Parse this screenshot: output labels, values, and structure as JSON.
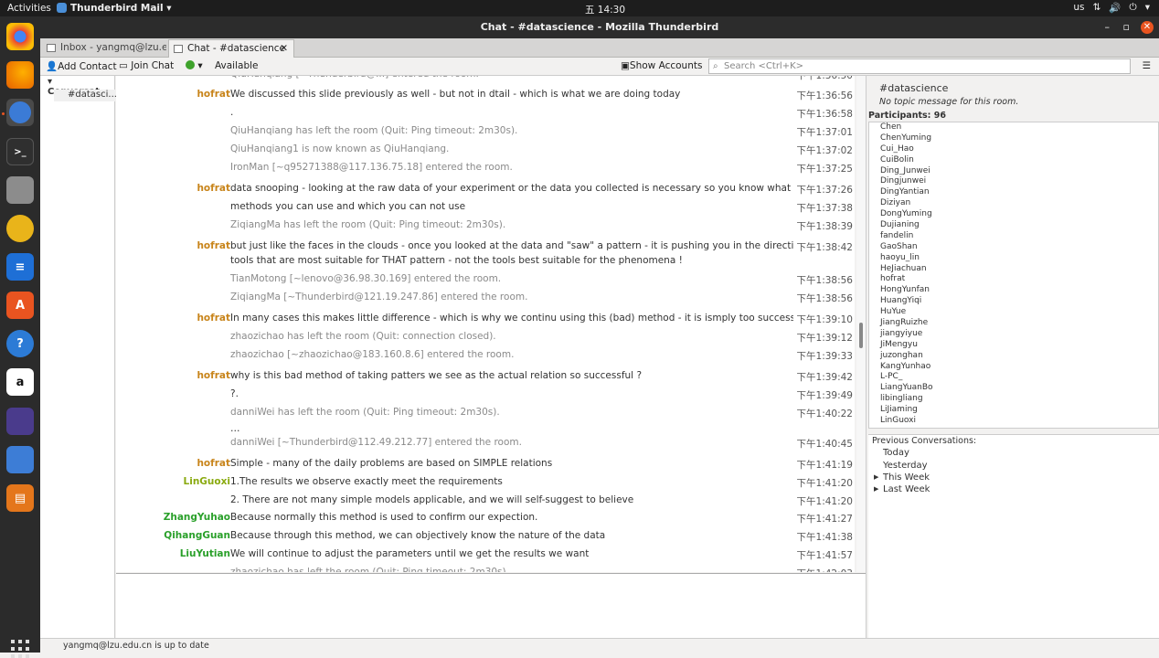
{
  "system": {
    "activities": "Activities",
    "app_name": "Thunderbird Mail",
    "clock": "五 14:30",
    "keyboard": "us"
  },
  "window": {
    "title": "Chat - #datascience - Mozilla Thunderbird"
  },
  "tabs": [
    {
      "label": "Inbox - yangmq@lzu.edu."
    },
    {
      "label": "Chat - #datascience"
    }
  ],
  "toolbar": {
    "add_contact": "Add Contact",
    "join_chat": "Join Chat",
    "status": "Available",
    "show_accounts": "Show Accounts",
    "search_placeholder": "Search <Ctrl+K>"
  },
  "sidebar": {
    "header": "Conversat...",
    "item": "#datasci..."
  },
  "chat": {
    "messages": [
      {
        "n": "",
        "m": "QiuHanqiang [~Thunderbird@...] entered the room.",
        "t": "下午1:36:50",
        "s": true,
        "nc": "#2aa02a"
      },
      {
        "n": "hofrat",
        "m": "We discussed this slide previously as well - but not in dtail - which is what we are doing today",
        "t": "下午1:36:56",
        "nc": "#c8841a"
      },
      {
        "n": "",
        "m": ".",
        "t": "下午1:36:58"
      },
      {
        "n": "",
        "m": "QiuHanqiang has left the room (Quit: Ping timeout: 2m30s).",
        "t": "下午1:37:01",
        "s": true
      },
      {
        "n": "",
        "m": "QiuHanqiang1 is now known as QiuHanqiang.",
        "t": "下午1:37:02",
        "s": true
      },
      {
        "n": "",
        "m": "IronMan [~q95271388@117.136.75.18] entered the room.",
        "t": "下午1:37:25",
        "s": true
      },
      {
        "n": "hofrat",
        "m": "data snooping - looking at the raw data of your experiment or the data you collected is necessary so you know what",
        "t": "下午1:37:26",
        "nc": "#c8841a"
      },
      {
        "n": "",
        "m": "methods you can use and which you can not use",
        "t": "下午1:37:38"
      },
      {
        "n": "",
        "m": "ZiqiangMa has left the room (Quit: Ping timeout: 2m30s).",
        "t": "下午1:38:39",
        "s": true
      },
      {
        "n": "hofrat",
        "m": "but just like the faces in the clouds - once you looked at the data and \"saw\" a pattern - it is pushing you in the direction of te",
        "t": "下午1:38:42",
        "nc": "#c8841a"
      },
      {
        "n": "",
        "m": "tools that are most suitable for THAT pattern - not the tools best suitable for the phenomena !",
        "t": ""
      },
      {
        "n": "",
        "m": "TianMotong [~lenovo@36.98.30.169] entered the room.",
        "t": "下午1:38:56",
        "s": true
      },
      {
        "n": "",
        "m": "ZiqiangMa [~Thunderbird@121.19.247.86] entered the room.",
        "t": "下午1:38:56",
        "s": true
      },
      {
        "n": "hofrat",
        "m": "In many cases this makes little difference - which is why we continu using this (bad) method - it is ismply too successful",
        "t": "下午1:39:10",
        "nc": "#c8841a"
      },
      {
        "n": "",
        "m": "zhaozichao has left the room (Quit: connection closed).",
        "t": "下午1:39:12",
        "s": true
      },
      {
        "n": "",
        "m": "zhaozichao [~zhaozichao@183.160.8.6] entered the room.",
        "t": "下午1:39:33",
        "s": true
      },
      {
        "n": "hofrat",
        "m": "why is this bad method of taking patters we see as the actual relation so successful ?",
        "t": "下午1:39:42",
        "nc": "#c8841a"
      },
      {
        "n": "",
        "m": "?.",
        "t": "下午1:39:49"
      },
      {
        "n": "",
        "m": "danniWei has left the room (Quit: Ping timeout: 2m30s).",
        "t": "下午1:40:22",
        "s": true
      },
      {
        "n": "",
        "m": "…",
        "t": ""
      },
      {
        "n": "",
        "m": "danniWei [~Thunderbird@112.49.212.77] entered the room.",
        "t": "下午1:40:45",
        "s": true
      },
      {
        "n": "hofrat",
        "m": "Simple - many of the daily problems are based on SIMPLE relations",
        "t": "下午1:41:19",
        "nc": "#c8841a"
      },
      {
        "n": "LinGuoxi",
        "m": "1.The results we observe exactly meet the requirements",
        "t": "下午1:41:20",
        "nc": "#8aaa10"
      },
      {
        "n": "",
        "m": "2. There are not many simple models applicable, and we will self-suggest to believe",
        "t": "下午1:41:20"
      },
      {
        "n": "ZhangYuhao",
        "m": "Because normally this method is used to confirm our expection.",
        "t": "下午1:41:27",
        "nc": "#2aa02a"
      },
      {
        "n": "QihangGuan",
        "m": "Because through this method, we can objectively know the nature of the data",
        "t": "下午1:41:38",
        "nc": "#2aa02a"
      },
      {
        "n": "LiuYutian",
        "m": "We will continue to adjust the parameters until we get the results we want",
        "t": "下午1:41:57",
        "nc": "#2aa02a"
      },
      {
        "n": "",
        "m": "zhaozichao has left the room (Quit: Ping timeout: 2m30s).",
        "t": "下午1:42:03",
        "s": true
      }
    ]
  },
  "room": {
    "name": "#datascience",
    "topic": "No topic message for this room.",
    "participants_label": "Participants:",
    "participants_count": "96"
  },
  "participants": [
    "Chen",
    "ChenYuming",
    "Cui_Hao",
    "CuiBolin",
    "Ding_Junwei",
    "Dingjunwei",
    "DingYantian",
    "Diziyan",
    "DongYuming",
    "Dujianing",
    "fandelin",
    "GaoShan",
    "haoyu_lin",
    "HeJiachuan",
    "hofrat",
    "HongYunfan",
    "HuangYiqi",
    "HuYue",
    "JiangRuizhe",
    "jiangyiyue",
    "JiMengyu",
    "juzonghan",
    "KangYunhao",
    "L-PC_",
    "LiangYuanBo",
    "libingliang",
    "LiJiaming",
    "LinGuoxi"
  ],
  "previous": {
    "header": "Previous Conversations:",
    "items": [
      "Today",
      "Yesterday",
      "This Week",
      "Last Week"
    ]
  },
  "statusbar": {
    "text": "yangmq@lzu.edu.cn is up to date"
  }
}
